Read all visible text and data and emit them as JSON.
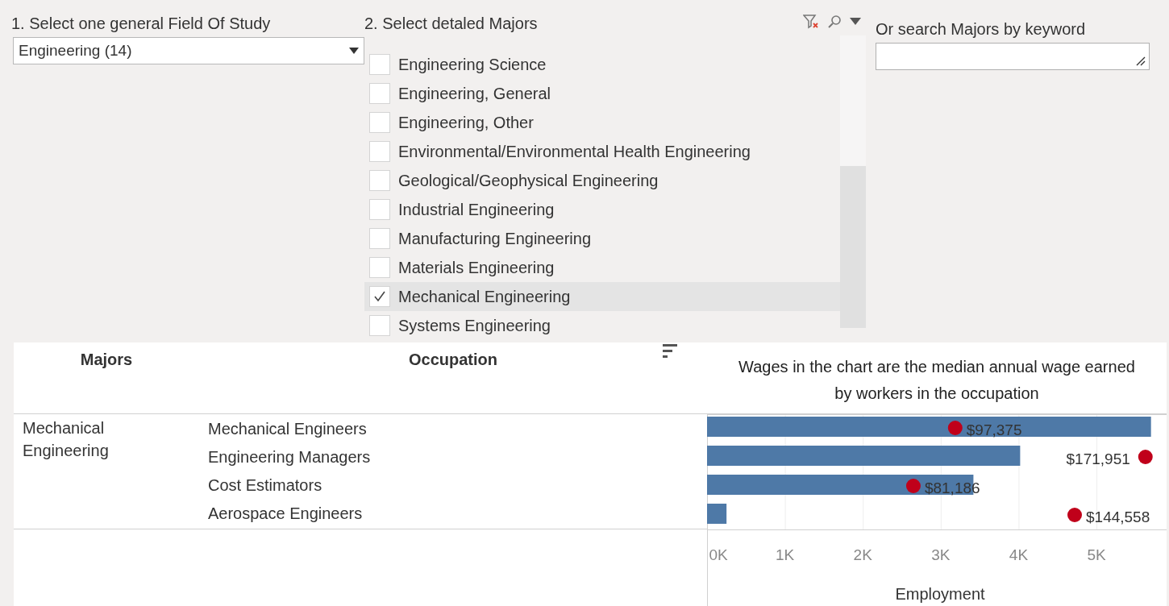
{
  "field_filter": {
    "title": "1. Select one general Field Of Study",
    "value": "Engineering (14)"
  },
  "majors_filter": {
    "title": "2. Select detaled Majors",
    "items": [
      {
        "label": "Engineering Science",
        "checked": false
      },
      {
        "label": "Engineering, General",
        "checked": false
      },
      {
        "label": "Engineering, Other",
        "checked": false
      },
      {
        "label": "Environmental/Environmental Health Engineering",
        "checked": false
      },
      {
        "label": "Geological/Geophysical Engineering",
        "checked": false
      },
      {
        "label": "Industrial Engineering",
        "checked": false
      },
      {
        "label": "Manufacturing Engineering",
        "checked": false
      },
      {
        "label": "Materials Engineering",
        "checked": false
      },
      {
        "label": "Mechanical Engineering",
        "checked": true
      },
      {
        "label": "Systems Engineering",
        "checked": false
      }
    ]
  },
  "keyword_search": {
    "title": "Or search Majors by keyword"
  },
  "table": {
    "columns": [
      "Majors",
      "Occupation"
    ],
    "major": "Mechanical Engineering",
    "occupations": [
      "Mechanical Engineers",
      "Engineering Managers",
      "Cost Estimators",
      "Aerospace Engineers"
    ],
    "chart_title": "Wages in the chart are the median annual wage earned by workers in the occupation",
    "wages": [
      "$97,375",
      "$171,951",
      "$81,186",
      "$144,558"
    ],
    "chart_data": {
      "type": "bar",
      "orientation": "horizontal",
      "xlabel": "Employment",
      "values": [
        5700,
        4020,
        3420,
        250
      ],
      "xlim": [
        0,
        5900
      ],
      "grid": true,
      "xticks": [
        {
          "value": 0,
          "label": "0K"
        },
        {
          "value": 1000,
          "label": "1K"
        },
        {
          "value": 2000,
          "label": "2K"
        },
        {
          "value": 3000,
          "label": "3K"
        },
        {
          "value": 4000,
          "label": "4K"
        },
        {
          "value": 5000,
          "label": "5K"
        }
      ]
    }
  }
}
